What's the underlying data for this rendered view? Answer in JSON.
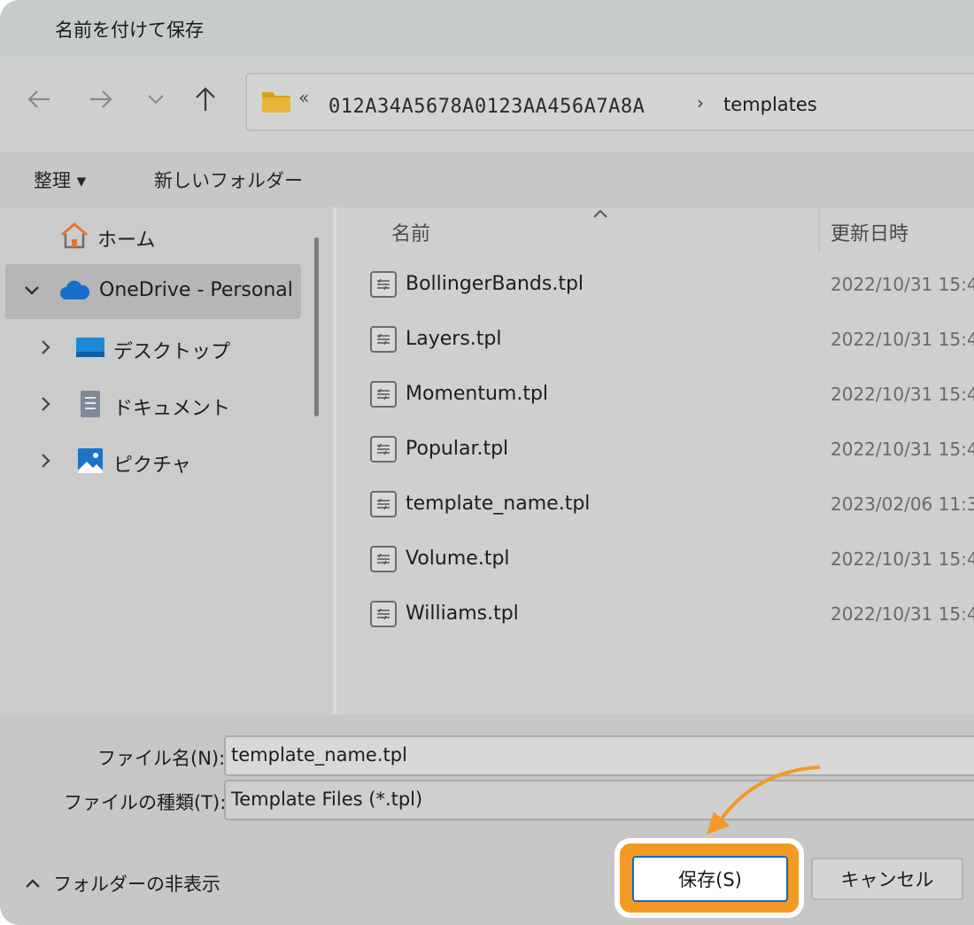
{
  "window": {
    "title": "名前を付けて保存"
  },
  "address_bar": {
    "overflow_chevron": "«",
    "crumbs": [
      "012A34A5678A0123AA456A7A8A",
      "templates"
    ],
    "separator": "›"
  },
  "toolbar": {
    "organize_label": "整理 ▾",
    "new_folder_label": "新しいフォルダー"
  },
  "sidebar": {
    "items": [
      {
        "label": "ホーム",
        "icon": "home-icon"
      },
      {
        "label": "OneDrive - Personal",
        "icon": "cloud-icon",
        "expanded": true,
        "selected": true
      },
      {
        "label": "デスクトップ",
        "icon": "desktop-icon"
      },
      {
        "label": "ドキュメント",
        "icon": "document-icon"
      },
      {
        "label": "ピクチャ",
        "icon": "picture-icon"
      }
    ]
  },
  "file_list": {
    "columns": [
      "名前",
      "更新日時"
    ],
    "rows": [
      {
        "name": "BollingerBands.tpl",
        "date": "2022/10/31 15:4"
      },
      {
        "name": "Layers.tpl",
        "date": "2022/10/31 15:4"
      },
      {
        "name": "Momentum.tpl",
        "date": "2022/10/31 15:4"
      },
      {
        "name": "Popular.tpl",
        "date": "2022/10/31 15:4"
      },
      {
        "name": "template_name.tpl",
        "date": "2023/02/06 11:3"
      },
      {
        "name": "Volume.tpl",
        "date": "2022/10/31 15:4"
      },
      {
        "name": "Williams.tpl",
        "date": "2022/10/31 15:4"
      }
    ]
  },
  "form": {
    "filename_label": "ファイル名(N):",
    "filename_value": "template_name.tpl",
    "filetype_label": "ファイルの種類(T):",
    "filetype_value": "Template Files (*.tpl)"
  },
  "footer": {
    "hide_folders_label": "フォルダーの非表示"
  },
  "buttons": {
    "save": "保存(S)",
    "cancel": "キャンセル"
  },
  "colors": {
    "highlight": "#f39a24",
    "accent": "#0b6bc7"
  }
}
